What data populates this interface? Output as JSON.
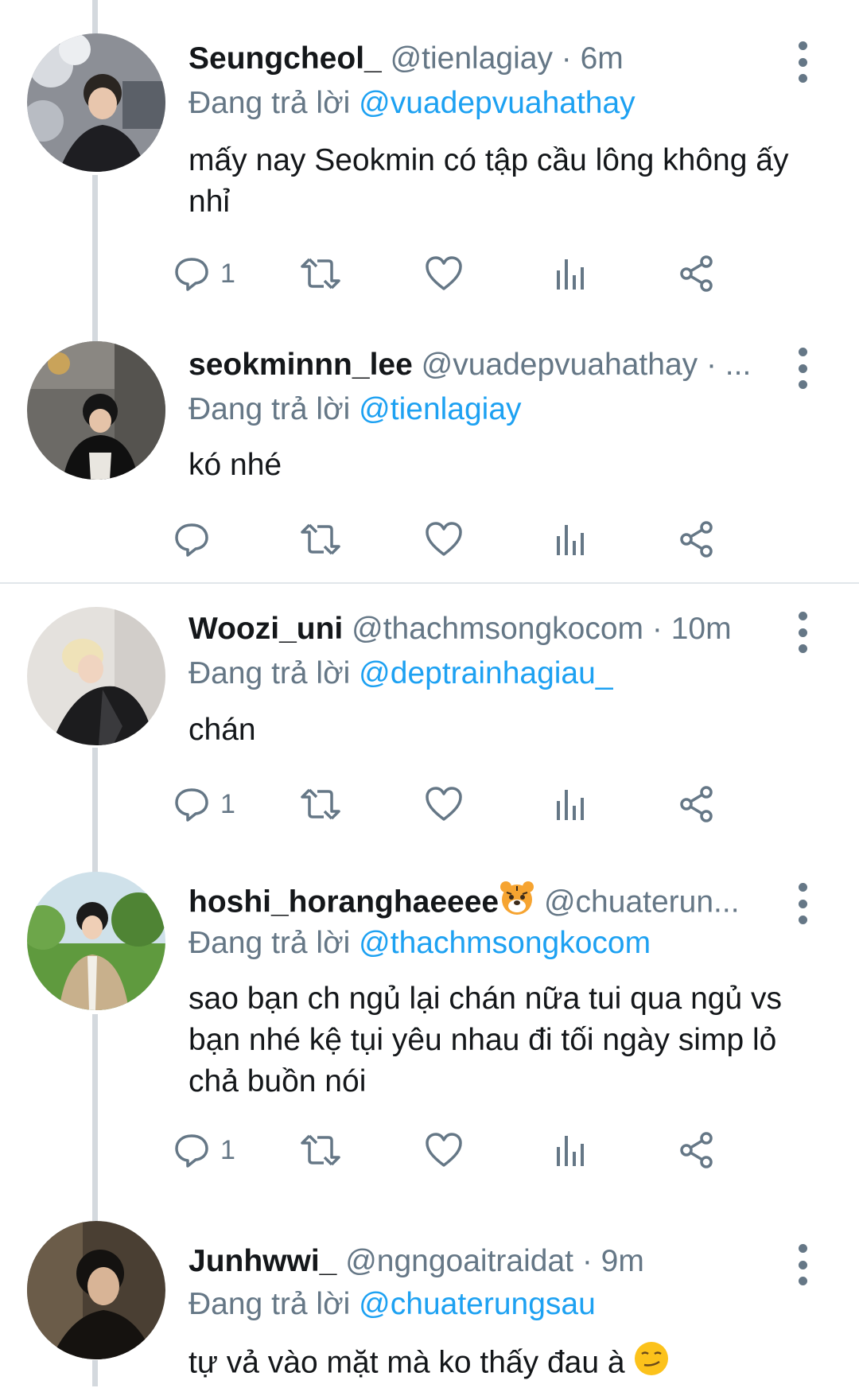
{
  "reply_prefix": "Đang trả lời",
  "tweets": [
    {
      "name": "Seungcheol_",
      "handle": "@tienlagiay",
      "meta": " · 6m",
      "reply_to": "@vuadepvuahathay",
      "text": "mấy nay Seokmin có tập cầu lông không ấy nhỉ",
      "reply_count": "1"
    },
    {
      "name": "seokminnn_lee",
      "handle": "@vuadepvuahathay",
      "meta": " · ...",
      "reply_to": "@tienlagiay",
      "text": "kó nhé",
      "reply_count": ""
    },
    {
      "name": "Woozi_uni",
      "handle": "@thachmsongkocom",
      "meta": " · 10m",
      "reply_to": "@deptrainhagiau_",
      "text": "chán",
      "reply_count": "1"
    },
    {
      "name": "hoshi_horanghaeeee",
      "handle": "@chuaterun...",
      "meta": "",
      "reply_to": "@thachmsongkocom",
      "text": "sao bạn ch ngủ lại chán nữa tui qua ngủ vs bạn nhé kệ tụi yêu nhau đi tối ngày simp lỏ chả buồn nói",
      "reply_count": "1",
      "name_emoji": "tiger-face-emoji"
    },
    {
      "name": "Junhwwi_",
      "handle": "@ngngoaitraidat",
      "meta": " · 9m",
      "reply_to": "@chuaterungsau",
      "text": "tự vả vào mặt mà ko thấy đau à",
      "text_emoji": "smirking-face-emoji"
    }
  ],
  "colors": {
    "accent": "#1da1f2",
    "secondary_text": "#657786",
    "thread_line": "#d4d9de"
  },
  "icons": [
    "reply-icon",
    "retweet-icon",
    "like-icon",
    "views-icon",
    "share-icon",
    "more-icon"
  ]
}
